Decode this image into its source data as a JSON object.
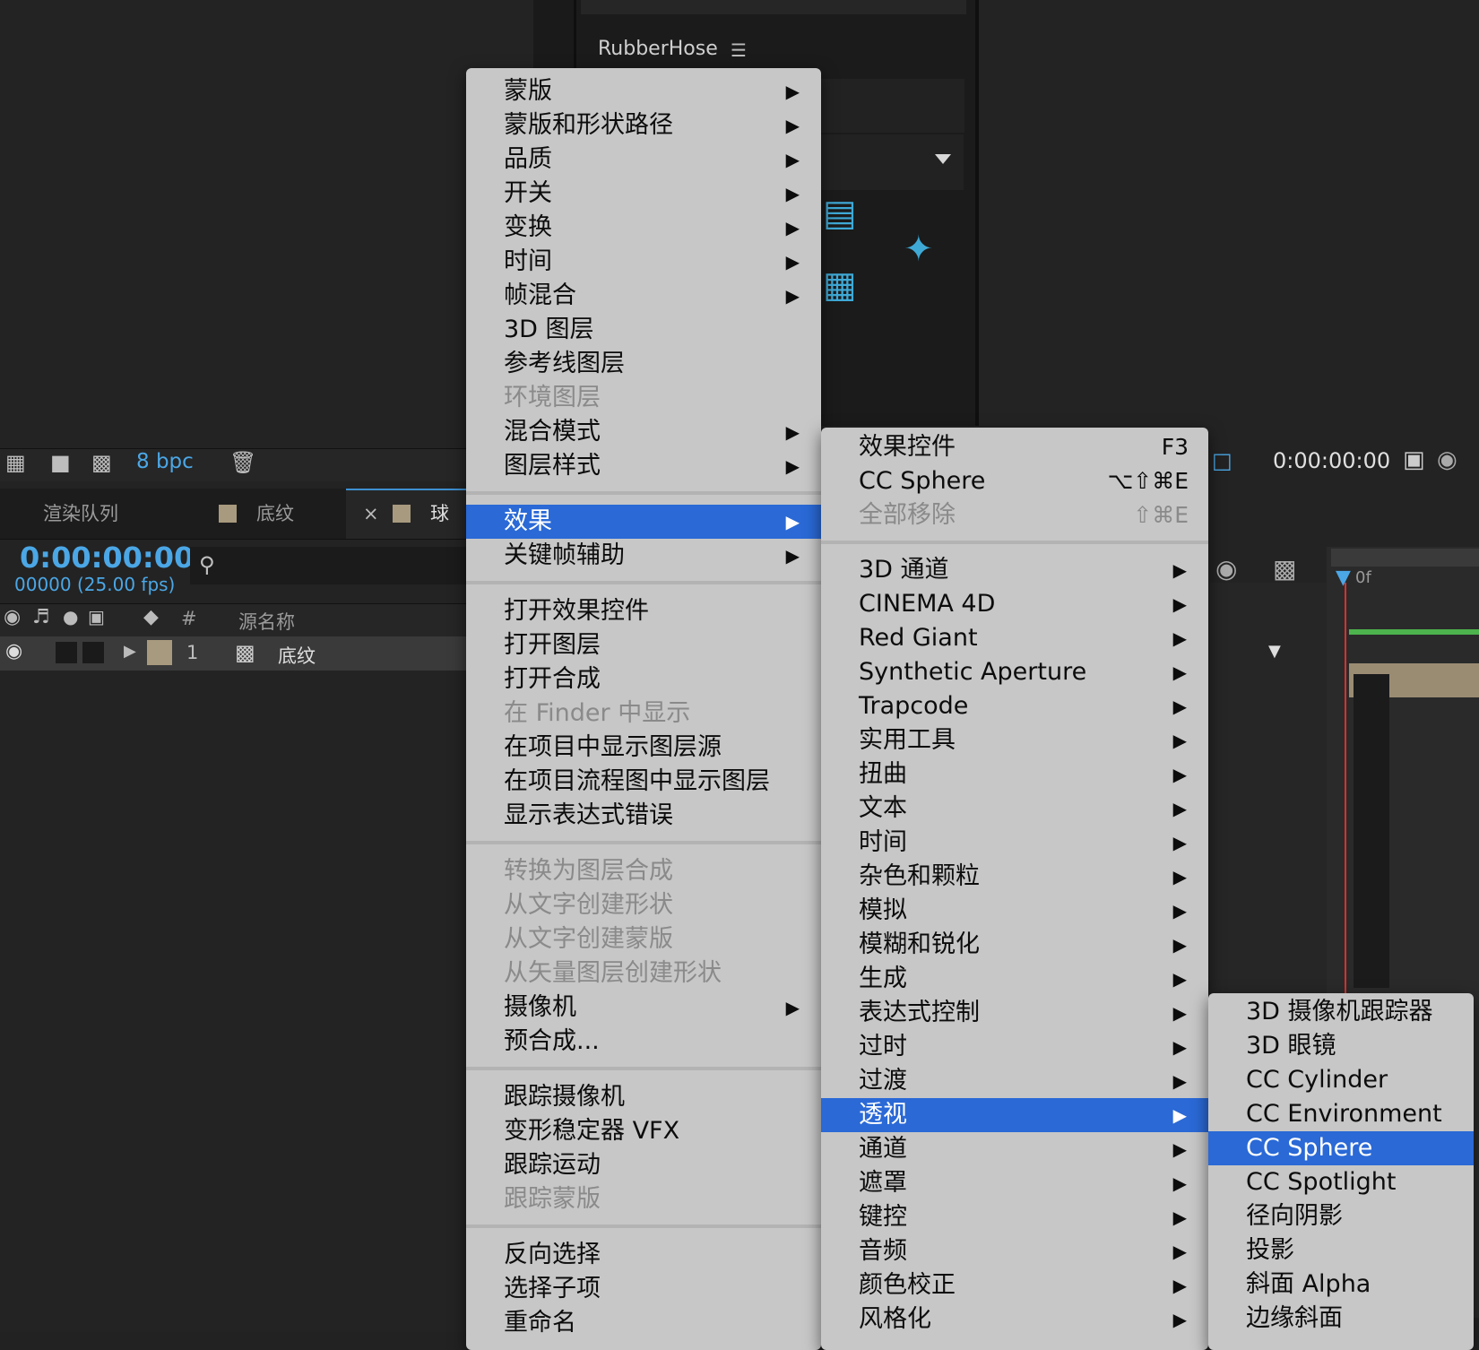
{
  "rubberhose": {
    "title": "RubberHose",
    "menu_glyph": "☰"
  },
  "project_footer": {
    "bpc": "8 bpc"
  },
  "tabs": [
    {
      "label": "渲染队列"
    },
    {
      "label": "底纹"
    },
    {
      "close": "×",
      "label": "球"
    }
  ],
  "timeline": {
    "timecode": "0:00:00:00",
    "fps": "00000 (25.00 fps)",
    "col_num": "#",
    "col_source": "源名称",
    "layer_num": "1",
    "layer_name": "底纹",
    "comp_timecode": "0:00:00:00",
    "ruler_label": "0f"
  },
  "menu1": {
    "items": [
      {
        "label": "蒙版",
        "arrow": "▶"
      },
      {
        "label": "蒙版和形状路径",
        "arrow": "▶"
      },
      {
        "label": "品质",
        "arrow": "▶"
      },
      {
        "label": "开关",
        "arrow": "▶"
      },
      {
        "label": "变换",
        "arrow": "▶"
      },
      {
        "label": "时间",
        "arrow": "▶"
      },
      {
        "label": "帧混合",
        "arrow": "▶"
      },
      {
        "label": "3D 图层"
      },
      {
        "label": "参考线图层"
      },
      {
        "label": "环境图层"
      },
      {
        "label": "混合模式",
        "arrow": "▶"
      },
      {
        "label": "图层样式",
        "arrow": "▶"
      },
      {
        "label": "效果",
        "arrow": "▶"
      },
      {
        "label": "关键帧辅助",
        "arrow": "▶"
      },
      {
        "label": "打开效果控件"
      },
      {
        "label": "打开图层"
      },
      {
        "label": "打开合成"
      },
      {
        "label": "在 Finder 中显示"
      },
      {
        "label": "在项目中显示图层源"
      },
      {
        "label": "在项目流程图中显示图层"
      },
      {
        "label": "显示表达式错误"
      },
      {
        "label": "转换为图层合成"
      },
      {
        "label": "从文字创建形状"
      },
      {
        "label": "从文字创建蒙版"
      },
      {
        "label": "从矢量图层创建形状"
      },
      {
        "label": "摄像机",
        "arrow": "▶"
      },
      {
        "label": "预合成..."
      },
      {
        "label": "跟踪摄像机"
      },
      {
        "label": "变形稳定器 VFX"
      },
      {
        "label": "跟踪运动"
      },
      {
        "label": "跟踪蒙版"
      },
      {
        "label": "反向选择"
      },
      {
        "label": "选择子项"
      },
      {
        "label": "重命名"
      }
    ]
  },
  "menu2": {
    "items": [
      {
        "label": "效果控件",
        "shortcut": "F3"
      },
      {
        "label": "CC Sphere",
        "shortcut": "⌥⇧⌘E"
      },
      {
        "label": "全部移除",
        "shortcut": "⇧⌘E"
      },
      {
        "label": "3D 通道",
        "arrow": "▶"
      },
      {
        "label": "CINEMA 4D",
        "arrow": "▶"
      },
      {
        "label": "Red Giant",
        "arrow": "▶"
      },
      {
        "label": "Synthetic Aperture",
        "arrow": "▶"
      },
      {
        "label": "Trapcode",
        "arrow": "▶"
      },
      {
        "label": "实用工具",
        "arrow": "▶"
      },
      {
        "label": "扭曲",
        "arrow": "▶"
      },
      {
        "label": "文本",
        "arrow": "▶"
      },
      {
        "label": "时间",
        "arrow": "▶"
      },
      {
        "label": "杂色和颗粒",
        "arrow": "▶"
      },
      {
        "label": "模拟",
        "arrow": "▶"
      },
      {
        "label": "模糊和锐化",
        "arrow": "▶"
      },
      {
        "label": "生成",
        "arrow": "▶"
      },
      {
        "label": "表达式控制",
        "arrow": "▶"
      },
      {
        "label": "过时",
        "arrow": "▶"
      },
      {
        "label": "过渡",
        "arrow": "▶"
      },
      {
        "label": "透视",
        "arrow": "▶"
      },
      {
        "label": "通道",
        "arrow": "▶"
      },
      {
        "label": "遮罩",
        "arrow": "▶"
      },
      {
        "label": "键控",
        "arrow": "▶"
      },
      {
        "label": "音频",
        "arrow": "▶"
      },
      {
        "label": "颜色校正",
        "arrow": "▶"
      },
      {
        "label": "风格化",
        "arrow": "▶"
      }
    ]
  },
  "menu3": {
    "items": [
      {
        "label": "3D 摄像机跟踪器"
      },
      {
        "label": "3D 眼镜"
      },
      {
        "label": "CC Cylinder"
      },
      {
        "label": "CC Environment"
      },
      {
        "label": "CC Sphere"
      },
      {
        "label": "CC Spotlight"
      },
      {
        "label": "径向阴影"
      },
      {
        "label": "投影"
      },
      {
        "label": "斜面 Alpha"
      },
      {
        "label": "边缘斜面"
      }
    ]
  },
  "colors": {
    "highlight": "#2a69d6",
    "menu_bg": "#c7c7c7",
    "accent_blue": "#4ba7e6"
  }
}
